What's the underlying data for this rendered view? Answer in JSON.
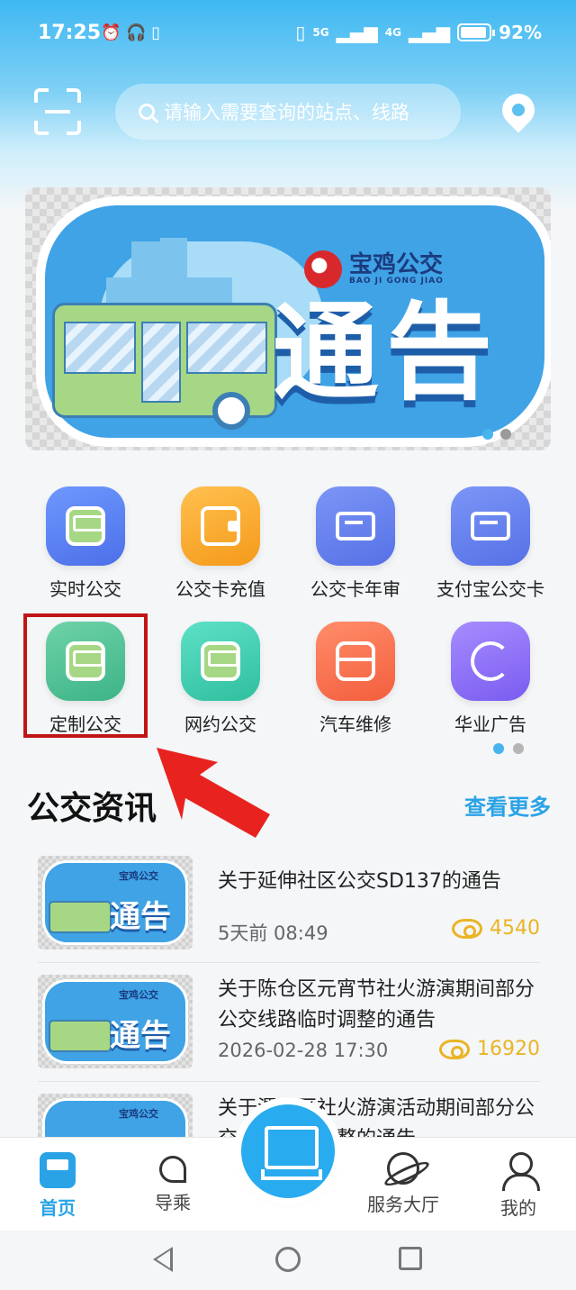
{
  "status_bar": {
    "time": "17:25",
    "network": "5G",
    "network2": "4G",
    "battery": "92%"
  },
  "header": {
    "search_placeholder": "请输入需要查询的站点、线路"
  },
  "banner": {
    "brand_cn": "宝鸡公交",
    "brand_en": "BAO JI GONG JIAO",
    "title": "通告",
    "page_count": 2,
    "active_page": 1
  },
  "services": [
    {
      "label": "实时公交",
      "icon": "bus-icon"
    },
    {
      "label": "公交卡充值",
      "icon": "wallet-icon"
    },
    {
      "label": "公交卡年审",
      "icon": "card-icon"
    },
    {
      "label": "支付宝公交卡",
      "icon": "card-icon"
    },
    {
      "label": "定制公交",
      "icon": "bus-front-icon"
    },
    {
      "label": "网约公交",
      "icon": "bus-side-icon"
    },
    {
      "label": "汽车维修",
      "icon": "box-icon"
    },
    {
      "label": "华业广告",
      "icon": "moon-icon"
    }
  ],
  "news": {
    "title": "公交资讯",
    "more": "查看更多",
    "thumb_brand": "宝鸡公交",
    "thumb_text": "通告",
    "items": [
      {
        "headline": "关于延伸社区公交SD137的通告",
        "time": "5天前  08:49",
        "views": "4540"
      },
      {
        "headline": "关于陈仓区元宵节社火游演期间部分公交线路临时调整的通告",
        "time": "2026-02-28 17:30",
        "views": "16920"
      },
      {
        "headline": "关于渭滨区社火游演活动期间部分公交线路临时调整的通告",
        "time": "",
        "views": ""
      }
    ]
  },
  "bottom_nav": {
    "home": "首页",
    "guide": "导乘",
    "service_hall": "服务大厅",
    "mine": "我的"
  },
  "colors": {
    "accent": "#2aa3e6",
    "highlight_box": "#c01515",
    "arrow": "#e8231f",
    "views": "#eab425"
  }
}
